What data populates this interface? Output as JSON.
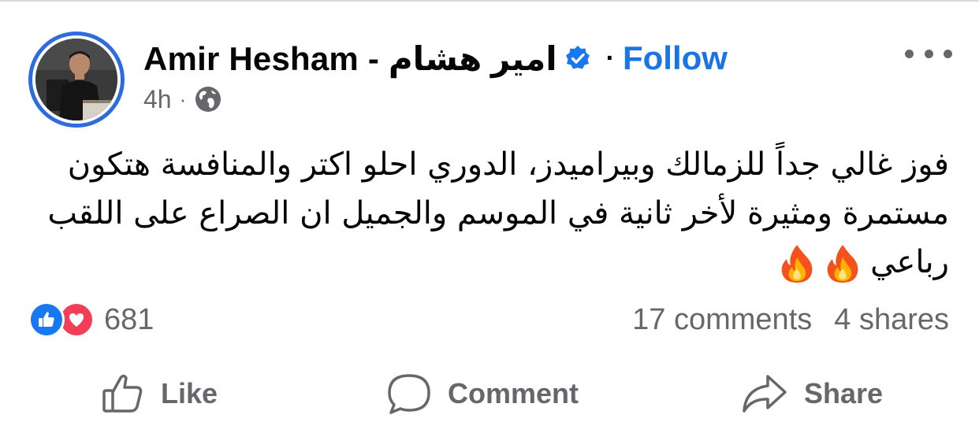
{
  "post": {
    "author": "Amir Hesham - امير هشام",
    "follow_label": "Follow",
    "dot": "·",
    "time": "4h",
    "meta_sep": "·",
    "text_lines": [
      "فوز غالي جداً للزمالك وبيراميدز، الدوري احلو اكتر والمنافسة هتكون",
      "مستمرة ومثيرة لأخر ثانية في الموسم والجميل ان الصراع على اللقب",
      "رباعي"
    ],
    "reactions_count": "681",
    "comments": "17 comments",
    "shares": "4 shares"
  },
  "actions": {
    "like": "Like",
    "comment": "Comment",
    "share": "Share"
  },
  "icons": {
    "verified": "verified-badge-icon",
    "privacy": "globe-icon",
    "more": "more-options-icon",
    "reaction_like": "thumbs-up-icon",
    "reaction_love": "heart-icon",
    "emoji": "fire-emoji"
  },
  "colors": {
    "accent": "#1b74e4",
    "secondary_text": "#65676b",
    "avatar_ring": "#2d6cdf",
    "like_blue": "#1877f2",
    "love_red": "#f33e58"
  }
}
